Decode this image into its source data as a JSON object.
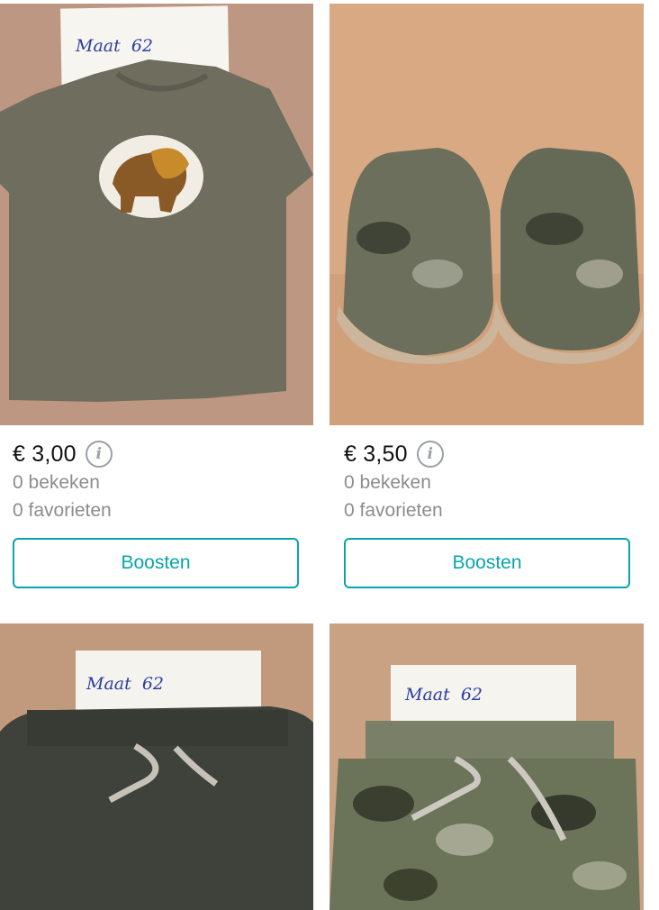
{
  "items": [
    {
      "price": "€ 3,00",
      "views": "0 bekeken",
      "favorites": "0 favorieten",
      "boost_label": "Boosten",
      "photo_label": "Maat  62"
    },
    {
      "price": "€ 3,50",
      "views": "0 bekeken",
      "favorites": "0 favorieten",
      "boost_label": "Boosten"
    },
    {
      "photo_label": "Maat  62"
    },
    {
      "photo_label": "Maat  62"
    }
  ],
  "colors": {
    "accent": "#09a4ac",
    "muted_text": "#8c8c8c",
    "price_text": "#111111"
  },
  "icons": [
    "info-icon"
  ]
}
